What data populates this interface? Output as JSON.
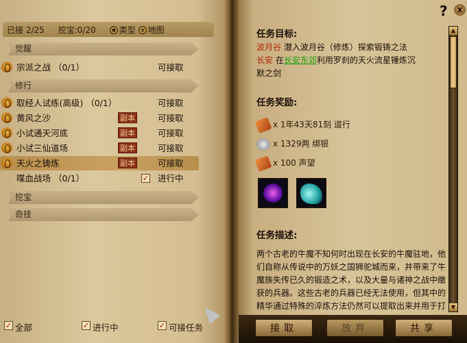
{
  "left": {
    "accepted_label": "已接 2/25",
    "dig_label": "挖宝:0/20",
    "sort_type": "类型",
    "sort_map": "地图",
    "categories": [
      "觉醒",
      "修行",
      "挖宝",
      "奇技"
    ],
    "rows": [
      {
        "name": "宗派之战 （0/1）",
        "status": "可接取"
      },
      {
        "name": "取经人试练(高级) （0/1）",
        "status": "可接取"
      },
      {
        "name": "黄风之沙",
        "badge": "副本",
        "status": "可接取"
      },
      {
        "name": "小试通天河底",
        "badge": "副本",
        "status": "可接取"
      },
      {
        "name": "小试三仙道场",
        "badge": "副本",
        "status": "可接取"
      },
      {
        "name": "天火之铸炼",
        "badge": "副本",
        "status": "可接取"
      },
      {
        "name": "喋血战场 （0/1）",
        "status": "进行中"
      }
    ],
    "filters": [
      "全部",
      "进行中",
      "可接任务"
    ]
  },
  "right": {
    "goal_title": "任务目标:",
    "goal_place1": "波月谷",
    "goal_text1": "潜入波月谷（修炼）探索锻铸之法",
    "goal_place2": "长安",
    "goal_text2a": "在",
    "goal_link": "长安东郊",
    "goal_text2b": "利用罗刹的天火流星锤炼沉",
    "goal_text3": "默之剑",
    "reward_title": "任务奖励:",
    "rewards": [
      "x 1年43天81刻 道行",
      "x 1329两 绑银",
      "x 100 声望"
    ],
    "desc_title": "任务描述:",
    "desc": "两个古老的牛魔不知何时出现在长安的牛魔驻地，他们自称从传说中的万妖之国狮驼城而来，并带来了牛魔族失传已久的锻造之术，以及大量与诸神之战中缴获的兵器。这些古老的兵器已经无法使用，但其中的精华通过特殊的淬炼方法仍然可以提取出来并用于打造属于你自己的神兵利器。"
  },
  "buttons": {
    "accept": "接取",
    "abandon": "放弃",
    "share": "共享"
  },
  "help_icon": "?",
  "close_icon": "x"
}
